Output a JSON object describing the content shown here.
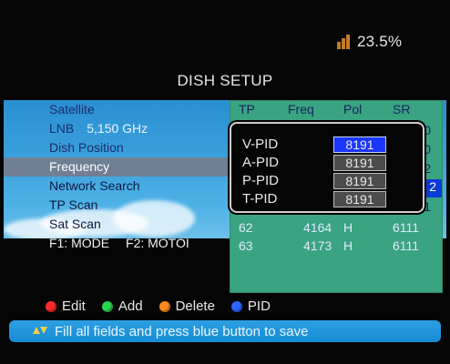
{
  "status": {
    "signal_text": "23.5%",
    "icon": "signal-icon",
    "accent": "#c57b2a"
  },
  "title": "DISH SETUP",
  "menu": {
    "items": [
      {
        "label": "Satellite"
      },
      {
        "label": "LNB",
        "value": "5,150 GHz"
      },
      {
        "label": "Dish Position"
      },
      {
        "label": "Frequency",
        "selected": true
      },
      {
        "label": "Network Search"
      },
      {
        "label": "TP Scan"
      },
      {
        "label": "Sat Scan"
      }
    ],
    "fkeys": [
      "F1: MODE",
      "F2: MOTOI"
    ]
  },
  "panel": {
    "headers": [
      "TP",
      "Freq",
      "Pol",
      "SR"
    ],
    "rows": [
      {
        "tp": "62",
        "freq": "4164",
        "pol": "H",
        "sr": "6111"
      },
      {
        "tp": "63",
        "freq": "4173",
        "pol": "H",
        "sr": "6111"
      }
    ],
    "edge_numbers": [
      "0",
      "0",
      "2",
      "2",
      "1"
    ],
    "colors": {
      "panel": "#3aa381",
      "header": "#14255e"
    }
  },
  "pid_popup": {
    "items": [
      {
        "label": "V-PID",
        "value": "8191",
        "active": true
      },
      {
        "label": "A-PID",
        "value": "8191"
      },
      {
        "label": "P-PID",
        "value": "8191"
      },
      {
        "label": "T-PID",
        "value": "8191"
      }
    ]
  },
  "keys": [
    {
      "label": "Edit",
      "color": "red"
    },
    {
      "label": "Add",
      "color": "green"
    },
    {
      "label": "Delete",
      "color": "orange"
    },
    {
      "label": "PID",
      "color": "blue"
    }
  ],
  "footer": {
    "hint": "Fill all fields and press blue button to save",
    "icon": "up-down-arrows-icon"
  }
}
